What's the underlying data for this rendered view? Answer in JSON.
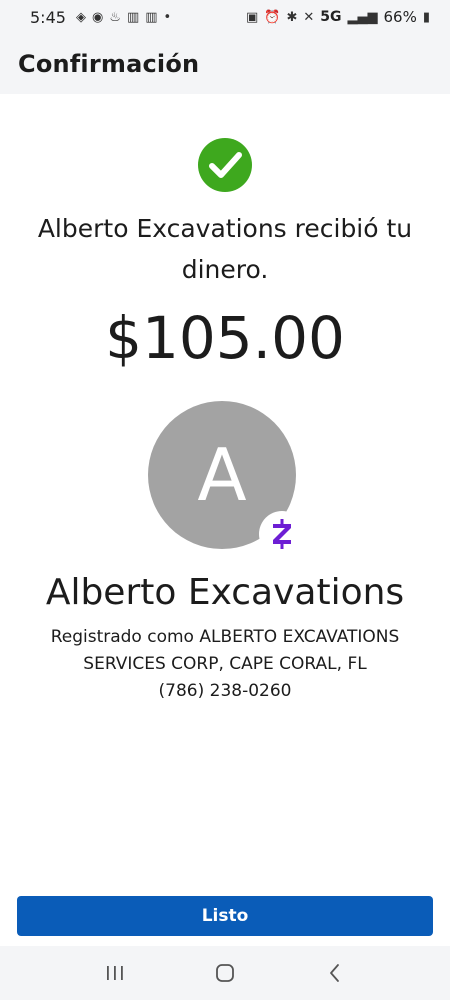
{
  "status_bar": {
    "time": "5:45",
    "network": "5G",
    "battery": "66%"
  },
  "header": {
    "title": "Confirmación"
  },
  "confirmation": {
    "message": "Alberto Excavations recibió tu dinero.",
    "amount": "$105.00",
    "avatar_initial": "A",
    "recipient_name": "Alberto Excavations",
    "registered_as": "Registrado como ALBERTO EXCAVATIONS SERVICES CORP, CAPE CORAL, FL",
    "phone": "(786) 238-0260"
  },
  "actions": {
    "done_label": "Listo"
  },
  "colors": {
    "primary": "#0a5cb8",
    "success": "#3ea81e",
    "zelle": "#6d1ed4",
    "avatar_bg": "#a3a3a3"
  },
  "icons": [
    "success-check-icon",
    "zelle-icon",
    "recents-icon",
    "home-icon",
    "back-icon"
  ]
}
